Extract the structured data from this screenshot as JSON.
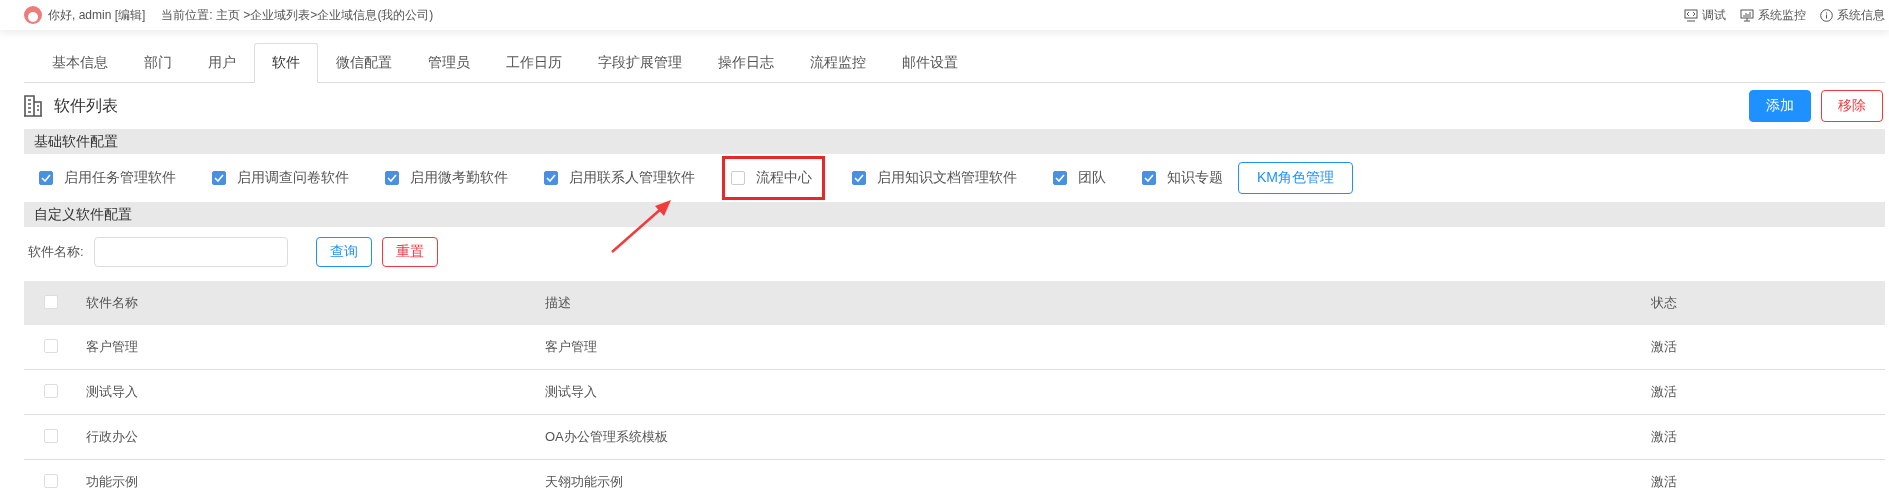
{
  "header": {
    "greeting": "你好, admin [编辑]",
    "breadcrumb": "当前位置: 主页 >企业域列表>企业域信息(我的公司)",
    "links": [
      {
        "kind": "debug",
        "label": "调试"
      },
      {
        "kind": "monitor",
        "label": "系统监控"
      },
      {
        "kind": "info",
        "label": "系统信息"
      }
    ]
  },
  "tabs": [
    {
      "label": "基本信息",
      "selected": false
    },
    {
      "label": "部门",
      "selected": false
    },
    {
      "label": "用户",
      "selected": false
    },
    {
      "label": "软件",
      "selected": true
    },
    {
      "label": "微信配置",
      "selected": false
    },
    {
      "label": "管理员",
      "selected": false
    },
    {
      "label": "工作日历",
      "selected": false
    },
    {
      "label": "字段扩展管理",
      "selected": false
    },
    {
      "label": "操作日志",
      "selected": false
    },
    {
      "label": "流程监控",
      "selected": false
    },
    {
      "label": "邮件设置",
      "selected": false
    }
  ],
  "section_title": "软件列表",
  "buttons": {
    "add": "添加",
    "remove": "移除"
  },
  "basic_config": {
    "title": "基础软件配置",
    "options": [
      {
        "label": "启用任务管理软件",
        "checked": true,
        "highlighted": false
      },
      {
        "label": "启用调查问卷软件",
        "checked": true,
        "highlighted": false
      },
      {
        "label": "启用微考勤软件",
        "checked": true,
        "highlighted": false
      },
      {
        "label": "启用联系人管理软件",
        "checked": true,
        "highlighted": false
      },
      {
        "label": "流程中心",
        "checked": false,
        "highlighted": true
      },
      {
        "label": "启用知识文档管理软件",
        "checked": true,
        "highlighted": false
      },
      {
        "label": "团队",
        "checked": true,
        "highlighted": false
      },
      {
        "label": "知识专题",
        "checked": true,
        "highlighted": false
      }
    ],
    "km_button": "KM角色管理"
  },
  "custom_config": {
    "title": "自定义软件配置",
    "search_label": "软件名称:",
    "query_button": "查询",
    "reset_button": "重置"
  },
  "table": {
    "header_checked": false,
    "columns": [
      "软件名称",
      "描述",
      "状态"
    ],
    "rows": [
      {
        "checked": false,
        "name": "客户管理",
        "description": "客户管理",
        "status": "激活"
      },
      {
        "checked": false,
        "name": "测试导入",
        "description": "测试导入",
        "status": "激活"
      },
      {
        "checked": false,
        "name": "行政办公",
        "description": "OA办公管理系统模板",
        "status": "激活"
      },
      {
        "checked": false,
        "name": "功能示例",
        "description": "天翎功能示例",
        "status": "激活"
      }
    ]
  }
}
